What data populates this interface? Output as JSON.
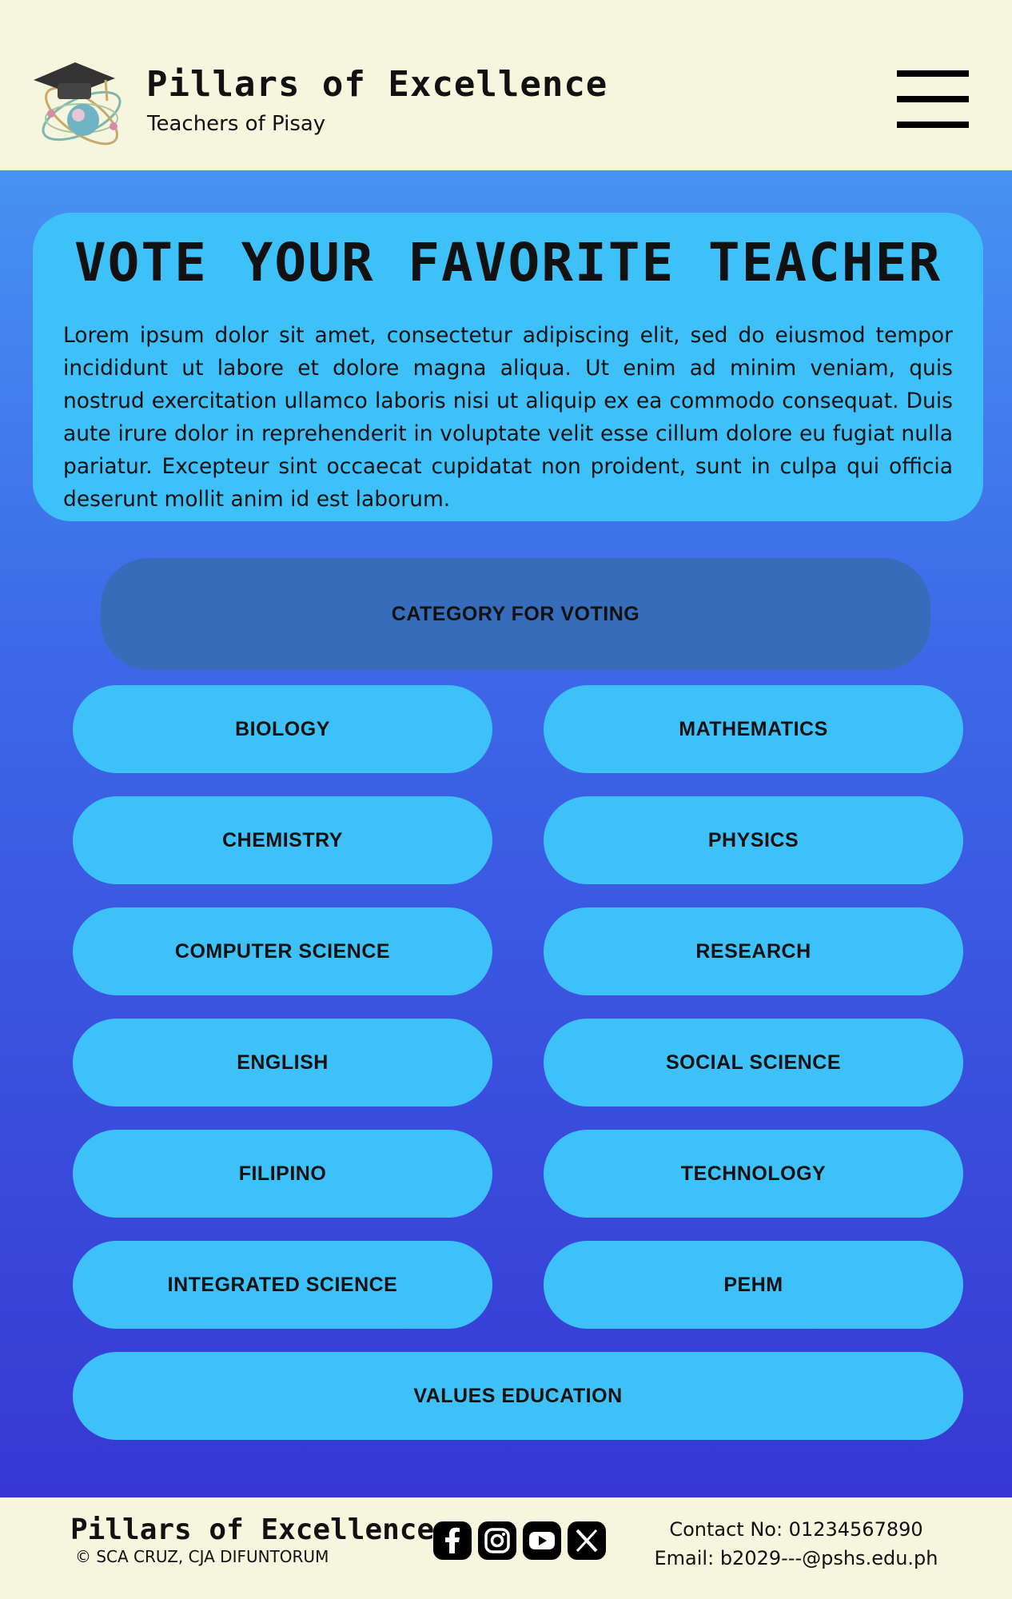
{
  "header": {
    "title": "Pillars of Excellence",
    "subtitle": "Teachers of Pisay",
    "logo_icon": "graduation-cap-atom-logo",
    "menu_icon": "hamburger-menu-icon"
  },
  "intro": {
    "heading": "VOTE YOUR FAVORITE TEACHER",
    "body": "Lorem ipsum dolor sit amet, consectetur adipiscing elit, sed do eiusmod tempor incididunt ut labore et dolore magna aliqua. Ut enim ad minim veniam, quis nostrud exercitation ullamco laboris nisi ut aliquip ex ea commodo consequat. Duis aute irure dolor in reprehenderit in voluptate velit esse cillum dolore eu fugiat nulla pariatur. Excepteur sint occaecat cupidatat non proident, sunt in culpa qui officia deserunt mollit anim id est laborum."
  },
  "categories": {
    "heading": "CATEGORY FOR VOTING",
    "items": [
      "BIOLOGY",
      "MATHEMATICS",
      "CHEMISTRY",
      "PHYSICS",
      "COMPUTER SCIENCE",
      "RESEARCH",
      "ENGLISH",
      "SOCIAL SCIENCE",
      "FILIPINO",
      "TECHNOLOGY",
      "INTEGRATED SCIENCE",
      "PEHM",
      "VALUES EDUCATION"
    ]
  },
  "footer": {
    "title": "Pillars of Excellence",
    "copyright": "© SCA CRUZ, CJA DIFUNTORUM",
    "social_icons": [
      "facebook-icon",
      "instagram-icon",
      "youtube-icon",
      "x-icon"
    ],
    "contact_line": "Contact No: 01234567890",
    "email_line": "Email: b2029---@pshs.edu.ph"
  },
  "colors": {
    "page_bg": "#f5f6dd",
    "card_blue": "#3ec0f8",
    "category_head_blue": "#366cba",
    "gradient_top": "#4792f3",
    "gradient_bottom": "#3738d3"
  }
}
